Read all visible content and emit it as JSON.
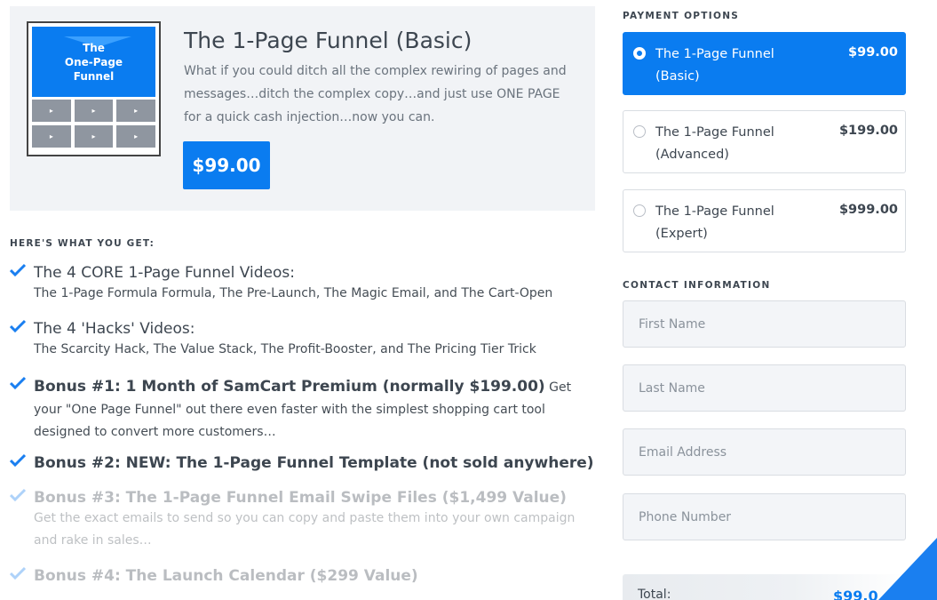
{
  "product": {
    "thumbnail_title": "The\nOne-Page\nFunnel",
    "thumbnail_tiles": [
      "▸",
      "▸",
      "▸",
      "▸",
      "▸",
      "▸"
    ],
    "title": "The 1-Page Funnel (Basic)",
    "description": "What if you could ditch all the complex rewiring of pages and messages…ditch the complex copy…and just use ONE PAGE for a quick cash injection…now you can.",
    "price": "$99.00"
  },
  "benefits": {
    "heading": "HERE'S WHAT YOU GET:",
    "items": [
      {
        "title": "The 4 CORE 1-Page Funnel Videos:",
        "body": "The 1-Page Formula Formula, The Pre-Launch, The Magic Email, and The Cart-Open"
      },
      {
        "title": "The 4 'Hacks' Videos:",
        "body": "The Scarcity Hack, The Value Stack, The Profit-Booster, and The Pricing Tier Trick"
      },
      {
        "title": "Bonus #1: 1 Month of SamCart Premium (normally $199.00)",
        "body_inline": " Get your \"One Page Funnel\" out there even faster with the simplest shopping cart tool designed to convert more customers…"
      },
      {
        "title": "Bonus #2: NEW: The 1-Page Funnel Template (not sold anywhere)"
      },
      {
        "title": "Bonus #3: The 1-Page Funnel Email Swipe Files ($1,499 Value)",
        "body": "Get the exact emails to send so you can copy and paste them into your own campaign and rake in sales…"
      },
      {
        "title": "Bonus #4: The Launch Calendar ($299 Value)"
      }
    ]
  },
  "payment": {
    "heading": "PAYMENT OPTIONS",
    "options": [
      {
        "name": "The 1-Page Funnel (Basic)",
        "price": "$99.00",
        "selected": true
      },
      {
        "name": "The 1-Page Funnel (Advanced)",
        "price": "$199.00",
        "selected": false
      },
      {
        "name": "The 1-Page Funnel (Expert)",
        "price": "$999.00",
        "selected": false
      }
    ]
  },
  "contact": {
    "heading": "CONTACT INFORMATION",
    "first_name": {
      "placeholder": "First Name",
      "value": ""
    },
    "last_name": {
      "placeholder": "Last Name",
      "value": ""
    },
    "email": {
      "placeholder": "Email Address",
      "value": ""
    },
    "phone": {
      "placeholder": "Phone Number",
      "value": ""
    }
  },
  "total": {
    "label": "Total:",
    "value": "$99.0"
  },
  "colors": {
    "accent": "#0a7cf0",
    "check": "#1a7ff0",
    "card_bg": "#f1f3f6"
  }
}
